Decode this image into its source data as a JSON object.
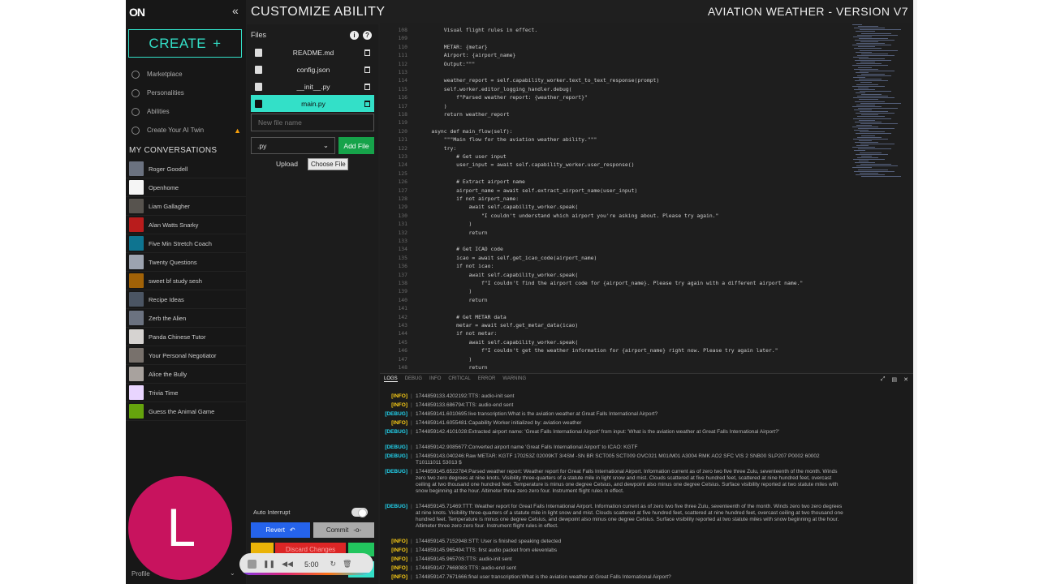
{
  "header": {
    "title": "CUSTOMIZE ABILITY",
    "version": "AVIATION WEATHER - VERSION V7"
  },
  "sidebar": {
    "logo": "ON",
    "create_label": "CREATE",
    "nav": [
      {
        "label": "Marketplace",
        "icon": "store-icon"
      },
      {
        "label": "Personalities",
        "icon": "smile-icon"
      },
      {
        "label": "Abilities",
        "icon": "ability-icon"
      },
      {
        "label": "Create Your AI Twin",
        "icon": "twin-icon"
      }
    ],
    "conversations_title": "MY CONVERSATIONS",
    "conversations": [
      {
        "label": "Roger Goodell",
        "color": "#6b7280"
      },
      {
        "label": "Openhome",
        "color": "#f5f5f5"
      },
      {
        "label": "Liam Gallagher",
        "color": "#57534e"
      },
      {
        "label": "Alan Watts Snarky",
        "color": "#b91c1c"
      },
      {
        "label": "Five Min Stretch Coach",
        "color": "#0e7490"
      },
      {
        "label": "Twenty Questions",
        "color": "#9ca3af"
      },
      {
        "label": "sweet bf study sesh",
        "color": "#a16207"
      },
      {
        "label": "Recipe Ideas",
        "color": "#4b5563"
      },
      {
        "label": "Zerb the Alien",
        "color": "#6b7280"
      },
      {
        "label": "Panda Chinese Tutor",
        "color": "#d6d3d1"
      },
      {
        "label": "Your Personal Negotiator",
        "color": "#78716c"
      },
      {
        "label": "Alice the Bully",
        "color": "#a8a29e"
      },
      {
        "label": "Trivia Time",
        "color": "#e9d5ff"
      },
      {
        "label": "Guess the Animal Game",
        "color": "#65a30d"
      }
    ],
    "avatar_letter": "L",
    "profile_label": "Profile"
  },
  "files": {
    "label": "Files",
    "items": [
      {
        "name": "README.md",
        "active": false
      },
      {
        "name": "config.json",
        "active": false
      },
      {
        "name": "__init__.py",
        "active": false
      },
      {
        "name": "main.py",
        "active": true
      }
    ],
    "new_file_placeholder": "New file name",
    "extension": ".py",
    "add_file_label": "Add File",
    "upload_label": "Upload",
    "choose_file_label": "Choose File",
    "auto_interrupt_label": "Auto Interrupt",
    "revert_label": "Revert",
    "commit_label": "Commit",
    "discard_label": "Discard Changes"
  },
  "media": {
    "time": "5:00"
  },
  "editor": {
    "lines": [
      {
        "n": "108",
        "code": "        Visual flight rules in effect."
      },
      {
        "n": "109",
        "code": ""
      },
      {
        "n": "110",
        "code": "        METAR: {metar}"
      },
      {
        "n": "111",
        "code": "        Airport: {airport_name}"
      },
      {
        "n": "112",
        "code": "        Output:\"\"\""
      },
      {
        "n": "113",
        "code": ""
      },
      {
        "n": "114",
        "code": "        weather_report = self.capability_worker.text_to_text_response(prompt)"
      },
      {
        "n": "115",
        "code": "        self.worker.editor_logging_handler.debug("
      },
      {
        "n": "116",
        "code": "            f\"Parsed weather report: {weather_report}\""
      },
      {
        "n": "117",
        "code": "        )"
      },
      {
        "n": "118",
        "code": "        return weather_report"
      },
      {
        "n": "119",
        "code": ""
      },
      {
        "n": "120",
        "code": "    async def main_flow(self):"
      },
      {
        "n": "121",
        "code": "        \"\"\"Main flow for the aviation weather ability.\"\"\""
      },
      {
        "n": "122",
        "code": "        try:"
      },
      {
        "n": "123",
        "code": "            # Get user input"
      },
      {
        "n": "124",
        "code": "            user_input = await self.capability_worker.user_response()"
      },
      {
        "n": "125",
        "code": ""
      },
      {
        "n": "126",
        "code": "            # Extract airport name"
      },
      {
        "n": "127",
        "code": "            airport_name = await self.extract_airport_name(user_input)"
      },
      {
        "n": "128",
        "code": "            if not airport_name:"
      },
      {
        "n": "129",
        "code": "                await self.capability_worker.speak("
      },
      {
        "n": "130",
        "code": "                    \"I couldn't understand which airport you're asking about. Please try again.\""
      },
      {
        "n": "131",
        "code": "                )"
      },
      {
        "n": "132",
        "code": "                return"
      },
      {
        "n": "133",
        "code": ""
      },
      {
        "n": "134",
        "code": "            # Get ICAO code"
      },
      {
        "n": "135",
        "code": "            icao = await self.get_icao_code(airport_name)"
      },
      {
        "n": "136",
        "code": "            if not icao:"
      },
      {
        "n": "137",
        "code": "                await self.capability_worker.speak("
      },
      {
        "n": "138",
        "code": "                    f\"I couldn't find the airport code for {airport_name}. Please try again with a different airport name.\""
      },
      {
        "n": "139",
        "code": "                )"
      },
      {
        "n": "140",
        "code": "                return"
      },
      {
        "n": "141",
        "code": ""
      },
      {
        "n": "142",
        "code": "            # Get METAR data"
      },
      {
        "n": "143",
        "code": "            metar = await self.get_metar_data(icao)"
      },
      {
        "n": "144",
        "code": "            if not metar:"
      },
      {
        "n": "145",
        "code": "                await self.capability_worker.speak("
      },
      {
        "n": "146",
        "code": "                    f\"I couldn't get the weather information for {airport_name} right now. Please try again later.\""
      },
      {
        "n": "147",
        "code": "                )"
      },
      {
        "n": "148",
        "code": "                return"
      }
    ]
  },
  "logs": {
    "tabs": [
      "LOGS",
      "DEBUG",
      "INFO",
      "CRITICAL",
      "ERROR",
      "WARNING"
    ],
    "entries": [
      {
        "level": "[INFO]",
        "kind": "info",
        "msg": "1744859133.4202192:TTS: audio-init sent"
      },
      {
        "level": "[INFO]",
        "kind": "info",
        "msg": "1744859133.686794:TTS: audio-end sent"
      },
      {
        "level": "[DEBUG]",
        "kind": "debug",
        "msg": "1744859141.6010695:live transcription:What is the aviation weather at Great Falls International Airport?"
      },
      {
        "level": "[INFO]",
        "kind": "info",
        "msg": "1744859141.6055481:Capability Worker initialized by: aviation weather"
      },
      {
        "level": "[DEBUG]",
        "kind": "debug",
        "msg": "1744859142.4101028:Extracted airport name: 'Great Falls International Airport' from input: 'What is the aviation weather at Great Falls International Airport?'"
      },
      {
        "level": "[DEBUG]",
        "kind": "debug",
        "msg": "1744859142.9085677:Converted airport name 'Great Falls International Airport' to ICAO: KGTF"
      },
      {
        "level": "[DEBUG]",
        "kind": "debug",
        "msg": "1744859143.040246:Raw METAR: KGTF 170253Z 02009KT 3/4SM -SN BR SCT005 SCT009 OVC021 M01/M01 A3004 RMK AO2 SFC VIS 2 SNB00 SLP207 P0002 60002 T10111011 53013 $"
      },
      {
        "level": "[DEBUG]",
        "kind": "debug",
        "msg": "1744859145.6522784:Parsed weather report: Weather report for Great Falls International Airport. Information current as of zero two five three Zulu, seventeenth of the month. Winds zero two zero degrees at nine knots. Visibility three-quarters of a statute mile in light snow and mist. Clouds scattered at five hundred feet, scattered at nine hundred feet, overcast ceiling at two thousand one hundred feet. Temperature is minus one degree Celsius, and dewpoint also minus one degree Celsius. Surface visibility reported at two statute miles with snow beginning at the hour. Altimeter three zero zero four. Instrument flight rules in effect."
      },
      {
        "level": "[DEBUG]",
        "kind": "debug",
        "msg": "1744859145.71469:TTT: Weather report for Great Falls International Airport. Information current as of zero two five three Zulu, seventeenth of the month. Winds zero two zero degrees at nine knots. Visibility three-quarters of a statute mile in light snow and mist. Clouds scattered at five hundred feet, scattered at nine hundred feet, overcast ceiling at two thousand one hundred feet. Temperature is minus one degree Celsius, and dewpoint also minus one degree Celsius. Surface visibility reported at two statute miles with snow beginning at the hour. Altimeter three zero zero four. Instrument flight rules in effect."
      },
      {
        "level": "[INFO]",
        "kind": "info",
        "msg": "1744859145.7152948:STT: User is finished speaking detected"
      },
      {
        "level": "[INFO]",
        "kind": "info",
        "msg": "1744859145.965494:TTS: first audio packet from elevenlabs"
      },
      {
        "level": "[INFO]",
        "kind": "info",
        "msg": "1744859145.96570S:TTS: audio-init sent"
      },
      {
        "level": "[INFO]",
        "kind": "info",
        "msg": "1744859147.7668083:TTS: audio-end sent"
      },
      {
        "level": "[INFO]",
        "kind": "info",
        "msg": "1744859147.7671666:final user transcription:What is the aviation weather at Great Falls International Airport?"
      }
    ]
  }
}
